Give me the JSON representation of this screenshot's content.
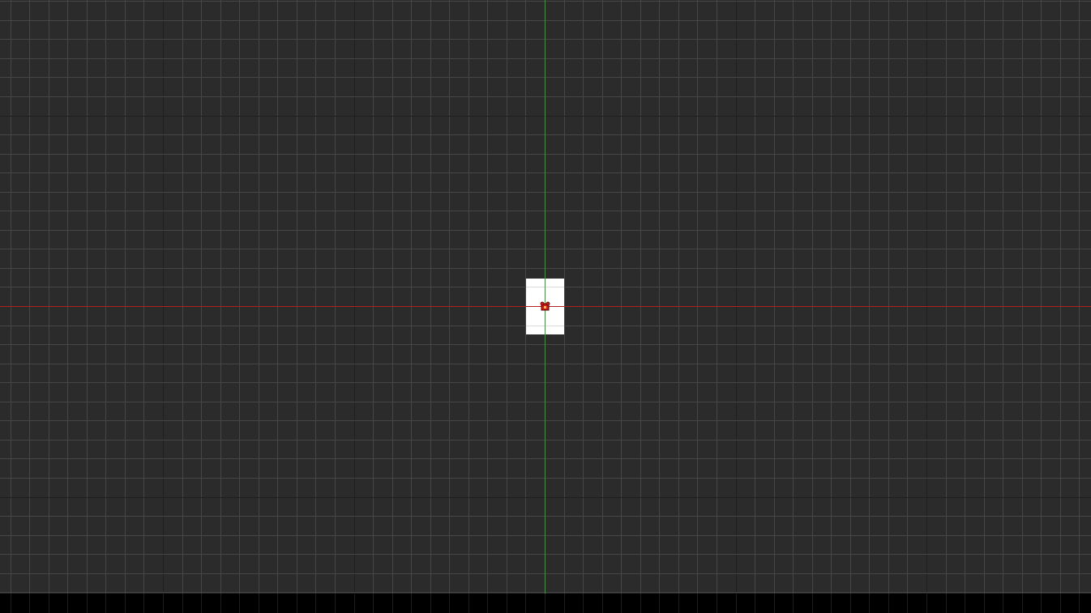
{
  "viewport": {
    "background_color": "#2b2b2b",
    "grid_minor_color": "#464646",
    "grid_major_color": "#1f1f1f",
    "bottom_bar_color": "#000000"
  },
  "axes": {
    "x_axis_color": "#b3201f",
    "y_axis_color": "#2aa52a"
  },
  "canvas_page": {
    "background_color": "#ffffff"
  },
  "origin_marker": {
    "icon": "origin-gizmo-icon",
    "color": "#d11a1a"
  }
}
